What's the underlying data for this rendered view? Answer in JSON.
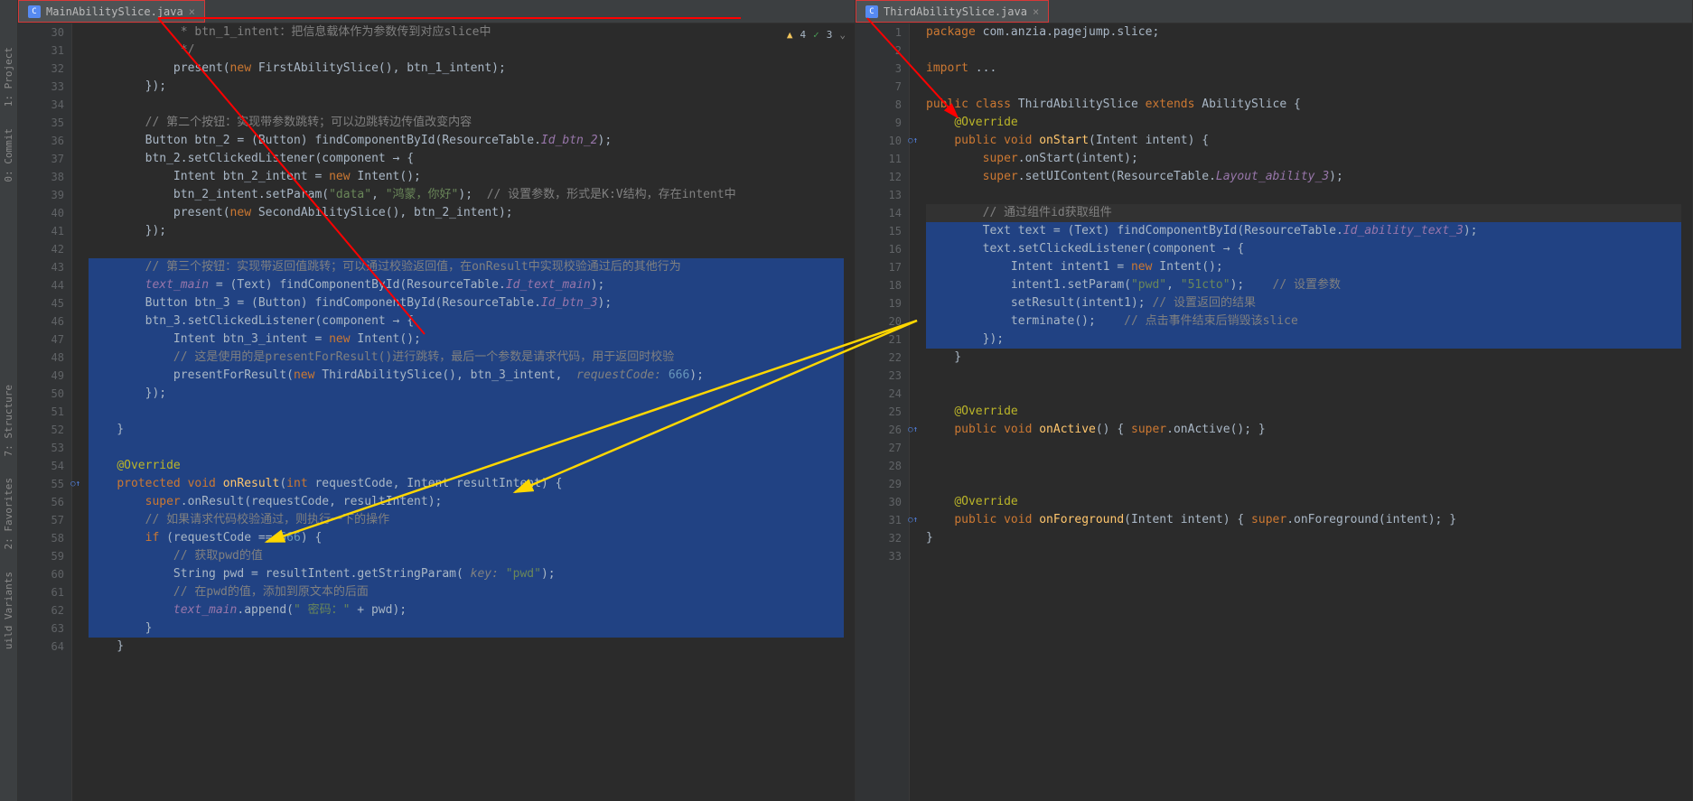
{
  "leftToolbar": {
    "items": [
      "1: Project",
      "0: Commit",
      "7: Structure",
      "2: Favorites",
      "uild Variants"
    ]
  },
  "leftPane": {
    "tab": {
      "name": "MainAbilitySlice.java",
      "type": "C"
    },
    "inspection": {
      "warnings": "4",
      "oks": "3"
    },
    "startLine": 30,
    "lines": [
      {
        "n": 30,
        "segs": [
          {
            "t": "             ",
            "c": ""
          },
          {
            "t": "* btn_1_intent：把信息载体作为参数传到对应slice中",
            "c": "cmt"
          }
        ]
      },
      {
        "n": 31,
        "segs": [
          {
            "t": "             ",
            "c": ""
          },
          {
            "t": "*/",
            "c": "cmt"
          }
        ]
      },
      {
        "n": 32,
        "segs": [
          {
            "t": "            present(",
            "c": ""
          },
          {
            "t": "new ",
            "c": "kw"
          },
          {
            "t": "FirstAbilitySlice(), btn_1_intent);",
            "c": ""
          }
        ]
      },
      {
        "n": 33,
        "segs": [
          {
            "t": "        });",
            "c": ""
          }
        ]
      },
      {
        "n": 34,
        "segs": []
      },
      {
        "n": 35,
        "segs": [
          {
            "t": "        ",
            "c": ""
          },
          {
            "t": "// 第二个按钮：实现带参数跳转；可以边跳转边传值改变内容",
            "c": "cmt"
          }
        ]
      },
      {
        "n": 36,
        "segs": [
          {
            "t": "        Button btn_2 = (Button) findComponentById(ResourceTable.",
            "c": ""
          },
          {
            "t": "Id_btn_2",
            "c": "field"
          },
          {
            "t": ");",
            "c": ""
          }
        ]
      },
      {
        "n": 37,
        "segs": [
          {
            "t": "        btn_2.setClickedListener(component ",
            "c": ""
          },
          {
            "t": "→",
            "c": ""
          },
          {
            "t": " {",
            "c": ""
          }
        ]
      },
      {
        "n": 38,
        "segs": [
          {
            "t": "            Intent btn_2_intent = ",
            "c": ""
          },
          {
            "t": "new ",
            "c": "kw"
          },
          {
            "t": "Intent();",
            "c": ""
          }
        ]
      },
      {
        "n": 39,
        "segs": [
          {
            "t": "            btn_2_intent.setParam(",
            "c": ""
          },
          {
            "t": "\"data\"",
            "c": "str"
          },
          {
            "t": ", ",
            "c": ""
          },
          {
            "t": "\"鸿蒙，你好\"",
            "c": "str"
          },
          {
            "t": ");  ",
            "c": ""
          },
          {
            "t": "// 设置参数，形式是K:V结构，存在intent中",
            "c": "cmt"
          }
        ]
      },
      {
        "n": 40,
        "segs": [
          {
            "t": "            present(",
            "c": ""
          },
          {
            "t": "new ",
            "c": "kw"
          },
          {
            "t": "SecondAbilitySlice(), btn_2_intent);",
            "c": ""
          }
        ]
      },
      {
        "n": 41,
        "segs": [
          {
            "t": "        });",
            "c": ""
          }
        ]
      },
      {
        "n": 42,
        "segs": []
      },
      {
        "n": 43,
        "sel": true,
        "segs": [
          {
            "t": "        ",
            "c": ""
          },
          {
            "t": "// 第三个按钮：实现带返回值跳转；可以通过校验返回值，在onResult中实现校验通过后的其他行为",
            "c": "cmt"
          }
        ]
      },
      {
        "n": 44,
        "sel": true,
        "segs": [
          {
            "t": "        ",
            "c": ""
          },
          {
            "t": "text_main",
            "c": "field"
          },
          {
            "t": " = (Text) findComponentById(ResourceTable.",
            "c": ""
          },
          {
            "t": "Id_text_main",
            "c": "field"
          },
          {
            "t": ");",
            "c": ""
          }
        ]
      },
      {
        "n": 45,
        "sel": true,
        "segs": [
          {
            "t": "        Button btn_3 = (Button) findComponentById(ResourceTable.",
            "c": ""
          },
          {
            "t": "Id_btn_3",
            "c": "field"
          },
          {
            "t": ");",
            "c": ""
          }
        ]
      },
      {
        "n": 46,
        "sel": true,
        "segs": [
          {
            "t": "        btn_3.setClickedListener(component ",
            "c": ""
          },
          {
            "t": "→",
            "c": ""
          },
          {
            "t": " {",
            "c": ""
          }
        ]
      },
      {
        "n": 47,
        "sel": true,
        "segs": [
          {
            "t": "            Intent btn_3_intent = ",
            "c": ""
          },
          {
            "t": "new ",
            "c": "kw"
          },
          {
            "t": "Intent();",
            "c": ""
          }
        ]
      },
      {
        "n": 48,
        "sel": true,
        "segs": [
          {
            "t": "            ",
            "c": ""
          },
          {
            "t": "// 这是使用的是presentForResult()进行跳转，最后一个参数是请求代码，用于返回时校验",
            "c": "cmt"
          }
        ]
      },
      {
        "n": 49,
        "sel": true,
        "segs": [
          {
            "t": "            ",
            "c": ""
          },
          {
            "t": "presentForResult(",
            "c": ""
          },
          {
            "t": "new ",
            "c": "kw"
          },
          {
            "t": "ThirdAbilitySlice(), btn_3_intent, ",
            "c": ""
          },
          {
            "t": " requestCode: ",
            "c": "param"
          },
          {
            "t": "666",
            "c": "num"
          },
          {
            "t": ");",
            "c": ""
          }
        ]
      },
      {
        "n": 50,
        "sel": true,
        "segs": [
          {
            "t": "        });",
            "c": ""
          }
        ]
      },
      {
        "n": 51,
        "sel": true,
        "segs": []
      },
      {
        "n": 52,
        "sel": true,
        "segs": [
          {
            "t": "    }",
            "c": ""
          }
        ]
      },
      {
        "n": 53,
        "sel": true,
        "segs": []
      },
      {
        "n": 54,
        "sel": true,
        "segs": [
          {
            "t": "    ",
            "c": ""
          },
          {
            "t": "@Override",
            "c": "anno"
          }
        ]
      },
      {
        "n": 55,
        "sel": true,
        "override": true,
        "segs": [
          {
            "t": "    ",
            "c": ""
          },
          {
            "t": "protected void ",
            "c": "kw"
          },
          {
            "t": "onResult",
            "c": "fn"
          },
          {
            "t": "(",
            "c": ""
          },
          {
            "t": "int ",
            "c": "kw"
          },
          {
            "t": "requestCode, Intent resultIntent) {",
            "c": ""
          }
        ]
      },
      {
        "n": 56,
        "sel": true,
        "segs": [
          {
            "t": "        ",
            "c": ""
          },
          {
            "t": "super",
            "c": "kw"
          },
          {
            "t": ".onResult(requestCode, resultIntent);",
            "c": ""
          }
        ]
      },
      {
        "n": 57,
        "sel": true,
        "segs": [
          {
            "t": "        ",
            "c": ""
          },
          {
            "t": "// 如果请求代码校验通过，则执行一下的操作",
            "c": "cmt"
          }
        ]
      },
      {
        "n": 58,
        "sel": true,
        "segs": [
          {
            "t": "        ",
            "c": ""
          },
          {
            "t": "if ",
            "c": "kw"
          },
          {
            "t": "(requestCode == ",
            "c": ""
          },
          {
            "t": "666",
            "c": "num"
          },
          {
            "t": ") {",
            "c": ""
          }
        ]
      },
      {
        "n": 59,
        "sel": true,
        "segs": [
          {
            "t": "            ",
            "c": ""
          },
          {
            "t": "// 获取pwd的值",
            "c": "cmt"
          }
        ]
      },
      {
        "n": 60,
        "sel": true,
        "segs": [
          {
            "t": "            String pwd = ",
            "c": ""
          },
          {
            "t": "resultIntent.getStringParam(",
            "c": ""
          },
          {
            "t": " key: ",
            "c": "param"
          },
          {
            "t": "\"pwd\"",
            "c": "str"
          },
          {
            "t": ");",
            "c": ""
          }
        ]
      },
      {
        "n": 61,
        "sel": true,
        "segs": [
          {
            "t": "            ",
            "c": ""
          },
          {
            "t": "// 在pwd的值，添加到原文本的后面",
            "c": "cmt"
          }
        ]
      },
      {
        "n": 62,
        "sel": true,
        "segs": [
          {
            "t": "            ",
            "c": ""
          },
          {
            "t": "text_main",
            "c": "field"
          },
          {
            "t": ".append(",
            "c": ""
          },
          {
            "t": "\" 密码：\"",
            "c": "str"
          },
          {
            "t": " + pwd);",
            "c": ""
          }
        ]
      },
      {
        "n": 63,
        "sel": true,
        "segs": [
          {
            "t": "        }",
            "c": ""
          }
        ]
      },
      {
        "n": 64,
        "segs": [
          {
            "t": "    }",
            "c": ""
          }
        ]
      }
    ]
  },
  "rightPane": {
    "tab": {
      "name": "ThirdAbilitySlice.java",
      "type": "C"
    },
    "startLine": 1,
    "lines": [
      {
        "n": 1,
        "segs": [
          {
            "t": "package ",
            "c": "kw"
          },
          {
            "t": "com.anzia.pagejump.slice;",
            "c": ""
          }
        ]
      },
      {
        "n": 2,
        "segs": []
      },
      {
        "n": 3,
        "segs": [
          {
            "t": "import ",
            "c": "kw"
          },
          {
            "t": "...",
            "c": ""
          }
        ]
      },
      {
        "n": 7,
        "segs": []
      },
      {
        "n": 8,
        "segs": [
          {
            "t": "public class ",
            "c": "kw"
          },
          {
            "t": "ThirdAbilitySlice ",
            "c": ""
          },
          {
            "t": "extends ",
            "c": "kw"
          },
          {
            "t": "AbilitySlice {",
            "c": ""
          }
        ]
      },
      {
        "n": 9,
        "segs": [
          {
            "t": "    ",
            "c": ""
          },
          {
            "t": "@Override",
            "c": "anno"
          }
        ]
      },
      {
        "n": 10,
        "override": true,
        "segs": [
          {
            "t": "    ",
            "c": ""
          },
          {
            "t": "public void ",
            "c": "kw"
          },
          {
            "t": "onStart",
            "c": "fn"
          },
          {
            "t": "(Intent intent) {",
            "c": ""
          }
        ]
      },
      {
        "n": 11,
        "segs": [
          {
            "t": "        ",
            "c": ""
          },
          {
            "t": "super",
            "c": "kw"
          },
          {
            "t": ".onStart(intent);",
            "c": ""
          }
        ]
      },
      {
        "n": 12,
        "segs": [
          {
            "t": "        ",
            "c": ""
          },
          {
            "t": "super",
            "c": "kw"
          },
          {
            "t": ".setUIContent(ResourceTable.",
            "c": ""
          },
          {
            "t": "Layout_ability_3",
            "c": "field"
          },
          {
            "t": ");",
            "c": ""
          }
        ]
      },
      {
        "n": 13,
        "segs": []
      },
      {
        "n": 14,
        "cur": true,
        "sel": true,
        "segs": [
          {
            "t": "        ",
            "c": ""
          },
          {
            "t": "// 通过组件id获取组件",
            "c": "cmt"
          }
        ]
      },
      {
        "n": 15,
        "sel": true,
        "segs": [
          {
            "t": "        Text text = (Text) findComponentById(ResourceTable.",
            "c": ""
          },
          {
            "t": "Id_ability_text_3",
            "c": "field"
          },
          {
            "t": ");",
            "c": ""
          }
        ]
      },
      {
        "n": 16,
        "sel": true,
        "segs": [
          {
            "t": "        text.setClickedListener(component ",
            "c": ""
          },
          {
            "t": "→",
            "c": ""
          },
          {
            "t": " {",
            "c": ""
          }
        ]
      },
      {
        "n": 17,
        "sel": true,
        "segs": [
          {
            "t": "            Intent intent1 = ",
            "c": ""
          },
          {
            "t": "new ",
            "c": "kw"
          },
          {
            "t": "Intent();",
            "c": ""
          }
        ]
      },
      {
        "n": 18,
        "sel": true,
        "segs": [
          {
            "t": "            ",
            "c": ""
          },
          {
            "t": "intent1.setParam(",
            "c": ""
          },
          {
            "t": "\"pwd\"",
            "c": "str"
          },
          {
            "t": ", ",
            "c": ""
          },
          {
            "t": "\"51cto\"",
            "c": "str"
          },
          {
            "t": ");",
            "c": ""
          },
          {
            "t": "    ",
            "c": ""
          },
          {
            "t": "// 设置参数",
            "c": "cmt"
          }
        ]
      },
      {
        "n": 19,
        "sel": true,
        "segs": [
          {
            "t": "            ",
            "c": ""
          },
          {
            "t": "setResult(intent1); ",
            "c": ""
          },
          {
            "t": "// 设置返回的结果",
            "c": "cmt"
          }
        ]
      },
      {
        "n": 20,
        "sel": true,
        "segs": [
          {
            "t": "            terminate();    ",
            "c": ""
          },
          {
            "t": "// 点击事件结束后销毁该slice",
            "c": "cmt"
          }
        ]
      },
      {
        "n": 21,
        "sel": true,
        "segs": [
          {
            "t": "        });",
            "c": ""
          }
        ]
      },
      {
        "n": 22,
        "segs": [
          {
            "t": "    }",
            "c": ""
          }
        ]
      },
      {
        "n": 23,
        "segs": []
      },
      {
        "n": 24,
        "segs": []
      },
      {
        "n": 25,
        "segs": [
          {
            "t": "    ",
            "c": ""
          },
          {
            "t": "@Override",
            "c": "anno"
          }
        ]
      },
      {
        "n": 26,
        "override": true,
        "segs": [
          {
            "t": "    ",
            "c": ""
          },
          {
            "t": "public void ",
            "c": "kw"
          },
          {
            "t": "onActive",
            "c": "fn"
          },
          {
            "t": "() { ",
            "c": ""
          },
          {
            "t": "super",
            "c": "kw"
          },
          {
            "t": ".onActive(); }",
            "c": ""
          }
        ]
      },
      {
        "n": 27,
        "segs": []
      },
      {
        "n": 28,
        "segs": []
      },
      {
        "n": 29,
        "segs": []
      },
      {
        "n": 30,
        "segs": [
          {
            "t": "    ",
            "c": ""
          },
          {
            "t": "@Override",
            "c": "anno"
          }
        ]
      },
      {
        "n": 31,
        "override": true,
        "segs": [
          {
            "t": "    ",
            "c": ""
          },
          {
            "t": "public void ",
            "c": "kw"
          },
          {
            "t": "onForeground",
            "c": "fn"
          },
          {
            "t": "(Intent intent) { ",
            "c": ""
          },
          {
            "t": "super",
            "c": "kw"
          },
          {
            "t": ".onForeground(intent); }",
            "c": ""
          }
        ]
      },
      {
        "n": 32,
        "segs": [
          {
            "t": "}",
            "c": ""
          }
        ]
      },
      {
        "n": 33,
        "segs": []
      }
    ]
  }
}
